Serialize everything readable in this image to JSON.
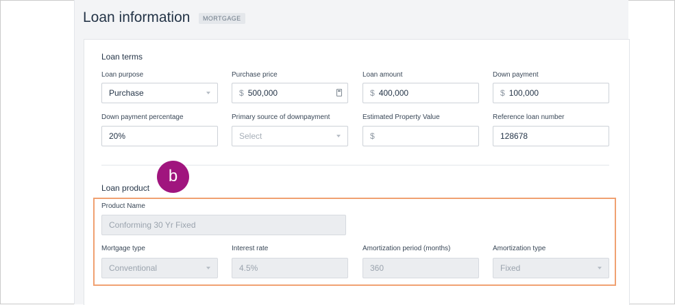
{
  "header": {
    "title": "Loan information",
    "badge": "MORTGAGE"
  },
  "loan_terms": {
    "heading": "Loan terms",
    "fields": {
      "loan_purpose": {
        "label": "Loan purpose",
        "value": "Purchase"
      },
      "purchase_price": {
        "label": "Purchase price",
        "prefix": "$",
        "value": "500,000"
      },
      "loan_amount": {
        "label": "Loan amount",
        "prefix": "$",
        "value": "400,000"
      },
      "down_payment": {
        "label": "Down payment",
        "prefix": "$",
        "value": "100,000"
      },
      "down_payment_percentage": {
        "label": "Down payment percentage",
        "value": "20%"
      },
      "primary_source": {
        "label": "Primary source of downpayment",
        "placeholder": "Select"
      },
      "estimated_property_value": {
        "label": "Estimated Property Value",
        "prefix": "$",
        "value": ""
      },
      "reference_loan_number": {
        "label": "Reference loan number",
        "value": "128678"
      }
    }
  },
  "callout": {
    "marker": "b",
    "color": "#a0157e",
    "highlight_color": "#f0a070"
  },
  "loan_product": {
    "heading": "Loan product",
    "fields": {
      "product_name": {
        "label": "Product Name",
        "value": "Conforming 30 Yr Fixed"
      },
      "mortgage_type": {
        "label": "Mortgage type",
        "value": "Conventional"
      },
      "interest_rate": {
        "label": "Interest rate",
        "value": "4.5%"
      },
      "amortization_period": {
        "label": "Amortization period (months)",
        "value": "360"
      },
      "amortization_type": {
        "label": "Amortization type",
        "value": "Fixed"
      }
    }
  },
  "icons": {
    "dropdown": "chevron-down-icon",
    "calculator": "calculator-icon"
  }
}
